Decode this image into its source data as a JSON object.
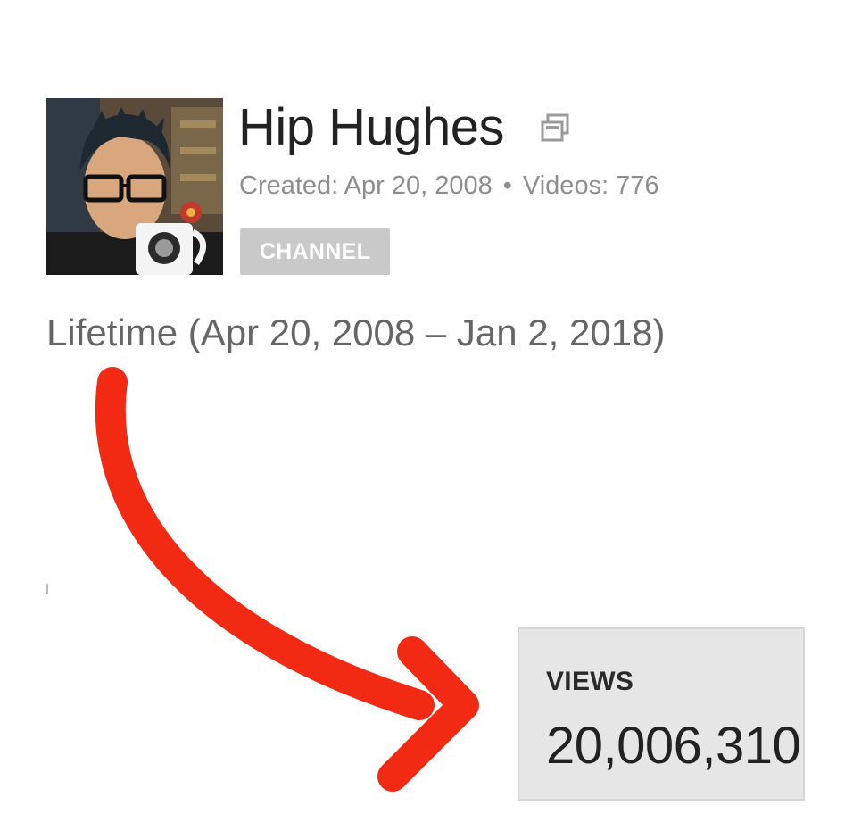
{
  "channel": {
    "name": "Hip Hughes",
    "created_label": "Created: Apr 20, 2008",
    "separator": "•",
    "videos_label": "Videos: 776",
    "badge": "CHANNEL",
    "avatar_icon": "channel-avatar",
    "external_icon": "external-link-icon"
  },
  "period": {
    "label": "Lifetime (Apr 20, 2008 – Jan 2, 2018)"
  },
  "stats": {
    "views_label": "VIEWS",
    "views_value": "20,006,310"
  },
  "annotation": {
    "arrow_color": "#f22a14"
  },
  "colors": {
    "badge_bg": "#c9c9c9",
    "meta_text": "#8e8e8e",
    "card_bg": "#e6e6e6"
  }
}
